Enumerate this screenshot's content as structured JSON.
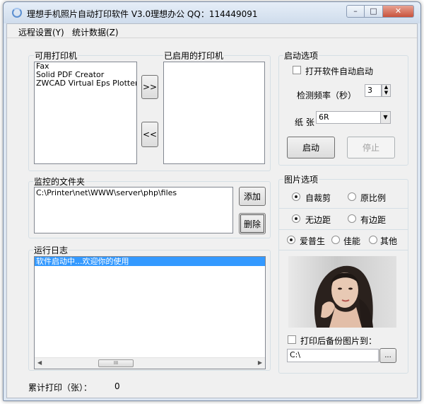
{
  "window": {
    "title": "理想手机照片自动打印软件 V3.0理想办公 QQ：114449091",
    "controls": {
      "minimize": "–",
      "maximize": "□",
      "close": "✕"
    }
  },
  "menu": {
    "items": [
      "远程设置(Y)",
      "统计数据(Z)"
    ]
  },
  "printers": {
    "available_label": "可用打印机",
    "available": [
      "Fax",
      "Solid PDF Creator",
      "ZWCAD Virtual Eps Plotter 1.0"
    ],
    "enabled_label": "已启用的打印机",
    "enabled": [],
    "add_button": ">>",
    "remove_button": "<<"
  },
  "watch_folder": {
    "label": "监控的文件夹",
    "paths": [
      "C:\\Printer\\net\\WWW\\server\\php\\files"
    ],
    "add_button": "添加",
    "delete_button": "删除"
  },
  "log": {
    "label": "运行日志",
    "entries": [
      "软件启动中...欢迎你的使用"
    ],
    "scroll_thumb": "III"
  },
  "startup": {
    "label": "启动选项",
    "autostart_label": "打开软件自动启动",
    "autostart_checked": false,
    "frequency_label": "检测频率（秒）",
    "frequency_value": "3",
    "paper_label": "纸 张",
    "paper_value": "6R",
    "start_button": "启动",
    "stop_button": "停止"
  },
  "image_options": {
    "label": "图片选项",
    "row1": {
      "selected": 0,
      "options": [
        "自裁剪",
        "原比例"
      ]
    },
    "row2": {
      "selected": 0,
      "options": [
        "无边距",
        "有边距"
      ]
    },
    "row3": {
      "selected": 0,
      "options": [
        "爱普生",
        "佳能",
        "其他"
      ]
    },
    "backup_label": "打印后备份图片到：",
    "backup_checked": false,
    "backup_path": "C:\\",
    "browse_button": "..."
  },
  "status": {
    "printed_label": "累计打印（张）：",
    "printed_count": "0"
  },
  "icons": {
    "arrow_up": "▲",
    "arrow_down": "▼",
    "combo": "▼",
    "scroll_left": "◀",
    "scroll_right": "▶"
  }
}
